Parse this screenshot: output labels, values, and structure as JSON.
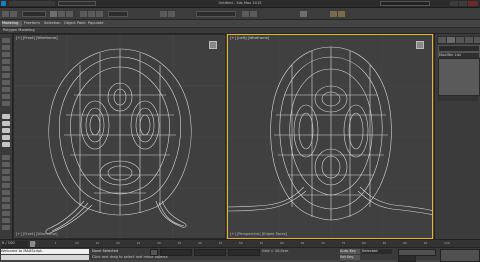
{
  "window": {
    "title": "Untitled - 3ds Max 2015"
  },
  "main_toolbar": {
    "workspace": "Workspace: Default"
  },
  "ribbon": {
    "tabs": [
      "Modeling",
      "Freeform",
      "Selection",
      "Object Paint",
      "Populate"
    ]
  },
  "subribbon": {
    "label": "Polygon Modeling"
  },
  "viewports": {
    "left": {
      "label": "[+] [Front] [Wireframe]",
      "footer": "[+] [Front] [Wireframe]"
    },
    "right": {
      "label": "[+] [Left] [Wireframe]",
      "footer": "[+] [Perspective] [Edged Faces]"
    }
  },
  "command_panel": {
    "name_field": "",
    "modifier_list": "Modifier List"
  },
  "timeline": {
    "ticks": [
      "0",
      "5",
      "10",
      "15",
      "20",
      "25",
      "30",
      "35",
      "40",
      "45",
      "50",
      "55",
      "60",
      "65",
      "70",
      "75",
      "80",
      "85",
      "90",
      "95",
      "100"
    ],
    "frame": "0 / 100"
  },
  "status": {
    "listener": "Welcome to MAXScript.",
    "prompt": "Click and drag to select and move objects",
    "selection": "None Selected",
    "grid": "Grid = 10.0cm",
    "auto_key": "Auto Key",
    "set_key": "Set Key",
    "selected": "Selected"
  },
  "colors": {
    "accent": "#e8b22a",
    "wire": "#d8d8d8",
    "viewport_bg": "#404040",
    "ui_dark": "#2b2b2b"
  }
}
